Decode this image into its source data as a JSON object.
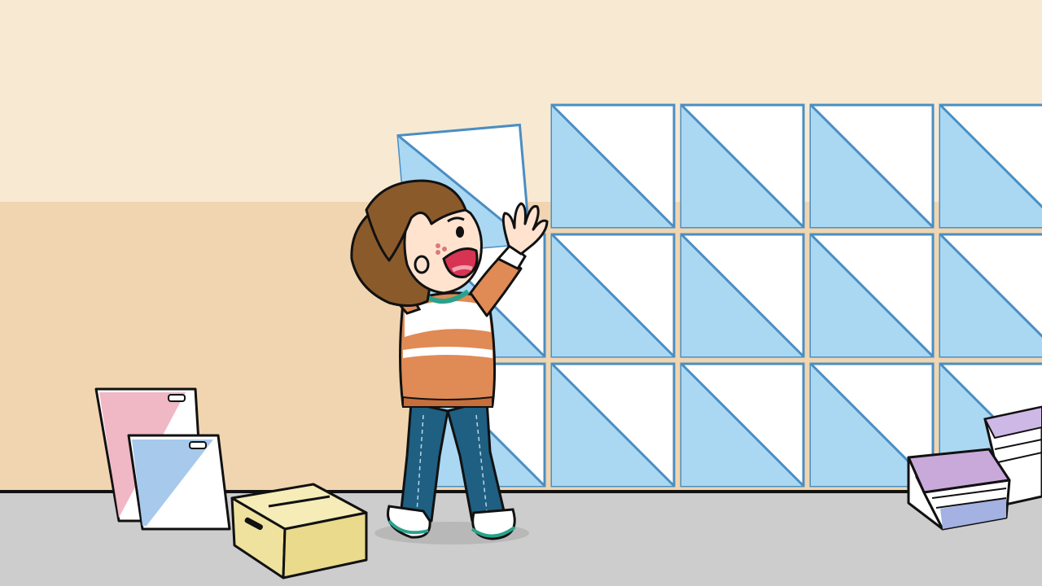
{
  "scene": {
    "colors": {
      "wall_upper": "#f8e9d3",
      "wall_lower": "#f0d5b0",
      "floor": "#cdcdcd",
      "tile_blue": "#aad8f3",
      "tile_white": "#ffffff",
      "tile_stroke": "#4a8ec2",
      "shirt_orange": "#e08a55",
      "jeans": "#1f5f82",
      "hair": "#8b5a2b",
      "box_yellow": "#f1e7a6"
    },
    "tile_wall": {
      "rows": 3,
      "columns": 4
    },
    "objects": [
      "wall",
      "floor",
      "tile-wall",
      "held-tile",
      "child",
      "leaning-tiles",
      "cardboard-box",
      "tile-stack"
    ]
  }
}
